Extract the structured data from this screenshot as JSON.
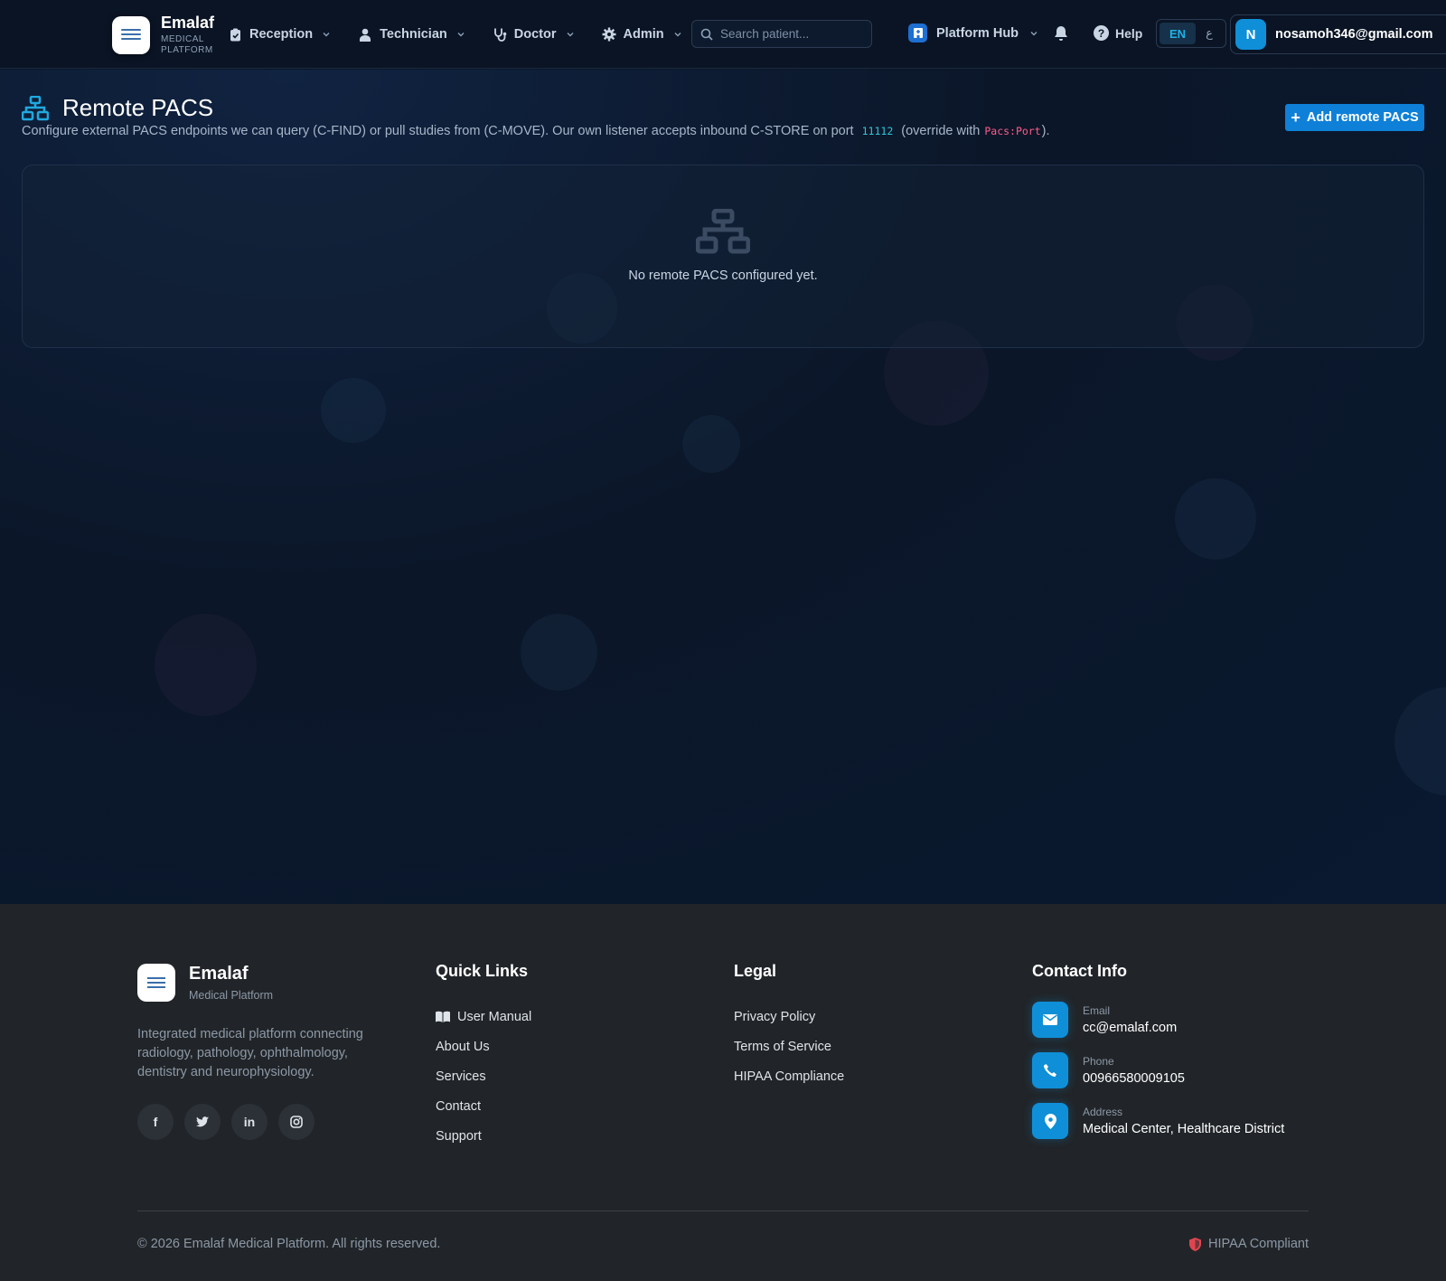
{
  "brand": {
    "name": "Emalaf",
    "sub": "MEDICAL PLATFORM"
  },
  "nav": {
    "items": [
      {
        "label": "Reception"
      },
      {
        "label": "Technician"
      },
      {
        "label": "Doctor"
      },
      {
        "label": "Admin"
      }
    ],
    "search_placeholder": "Search patient...",
    "hub_label": "Platform Hub",
    "help_label": "Help",
    "lang_active": "EN",
    "lang_alt": "ع",
    "user": {
      "initial": "N",
      "email": "nosamoh346@gmail.com"
    }
  },
  "page": {
    "title": "Remote PACS",
    "desc_before": "Configure external PACS endpoints we can query (C-FIND) or pull studies from (C-MOVE). Our own listener accepts inbound C-STORE on port",
    "port": "11112",
    "desc_middle": "(override with",
    "config_key": "Pacs:Port",
    "desc_after": ").",
    "add_button": "Add remote PACS",
    "empty_text": "No remote PACS configured yet."
  },
  "footer": {
    "brand_name": "Emalaf",
    "brand_sub": "Medical Platform",
    "description": "Integrated medical platform connecting radiology, pathology, ophthalmology, dentistry and neurophysiology.",
    "socials": [
      "facebook-icon",
      "twitter-icon",
      "linkedin-icon",
      "instagram-icon"
    ],
    "quick_links_title": "Quick Links",
    "quick_links": [
      "User Manual",
      "About Us",
      "Services",
      "Contact",
      "Support"
    ],
    "legal_title": "Legal",
    "legal_links": [
      "Privacy Policy",
      "Terms of Service",
      "HIPAA Compliance"
    ],
    "contact_title": "Contact Info",
    "contact": [
      {
        "label": "Email",
        "value": "cc@emalaf.com"
      },
      {
        "label": "Phone",
        "value": "00966580009105"
      },
      {
        "label": "Address",
        "value": "Medical Center, Healthcare District"
      }
    ],
    "copyright": "© 2026 Emalaf Medical Platform. All rights reserved.",
    "hipaa_badge": "HIPAA Compliant"
  },
  "colors": {
    "accent": "#0f80d8",
    "background": "#0b1628",
    "footer": "#212529"
  }
}
